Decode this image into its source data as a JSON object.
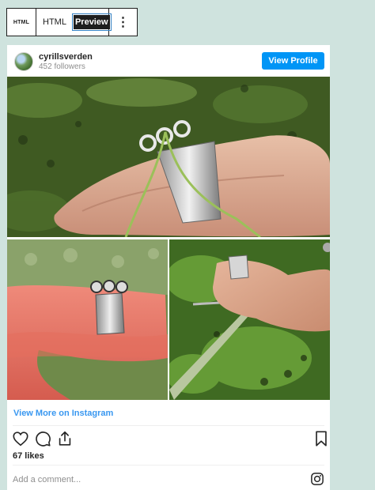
{
  "toolbar": {
    "icon_label": "HTML",
    "html_label": "HTML",
    "preview_label": "Preview",
    "more_icon": "more-vertical-icon"
  },
  "post": {
    "username": "cyrillsverden",
    "followers": "452 followers",
    "view_profile": "View Profile",
    "view_more": "View More on Instagram",
    "likes": "67 likes",
    "comment_placeholder": "Add a comment...",
    "icons": [
      "heart-icon",
      "comment-icon",
      "share-icon",
      "bookmark-icon",
      "instagram-icon"
    ]
  },
  "colors": {
    "background": "#cfe3de",
    "button_blue": "#0095f6",
    "link_blue": "#3897f0",
    "toolbar_dark": "#1e1e1e"
  }
}
